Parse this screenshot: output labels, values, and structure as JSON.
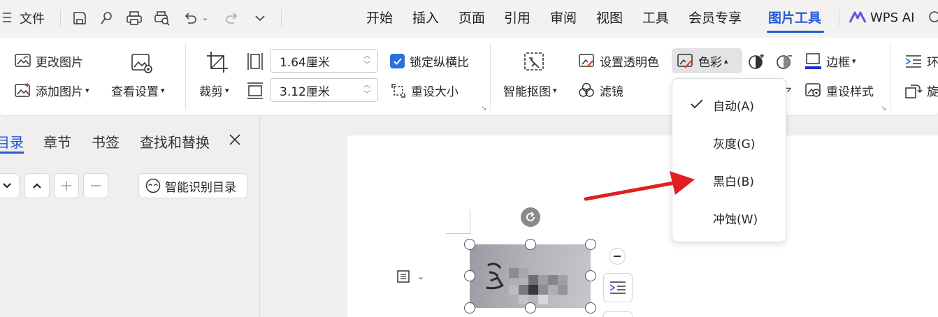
{
  "titlebar": {
    "file_label": "文件",
    "menu": [
      "开始",
      "插入",
      "页面",
      "引用",
      "审阅",
      "视图",
      "工具",
      "会员专享",
      "图片工具"
    ],
    "ai_label": "WPS AI"
  },
  "ribbon": {
    "change_picture": "更改图片",
    "add_picture": "添加图片",
    "view_settings": "查看设置",
    "crop": "裁剪",
    "width_value": "1.64厘米",
    "height_value": "3.12厘米",
    "lock_ratio": "锁定纵横比",
    "reset_size": "重设大小",
    "smart_cutout": "智能抠图",
    "set_transparent": "设置透明色",
    "color": "色彩",
    "filter": "滤镜",
    "border": "边框",
    "reset_style": "重设样式",
    "wrap_partial": "环",
    "rotate_partial": "旋"
  },
  "nav": {
    "tabs": [
      "目录",
      "章节",
      "书签",
      "查找和替换"
    ],
    "smart_toc": "智能识别目录"
  },
  "color_menu": {
    "items": [
      "自动(A)",
      "灰度(G)",
      "黑白(B)",
      "冲蚀(W)"
    ],
    "checked_index": 0
  },
  "colors": {
    "accent": "#2459d8",
    "annotation_arrow": "#e02020",
    "checkbox": "#2b6fe0"
  }
}
